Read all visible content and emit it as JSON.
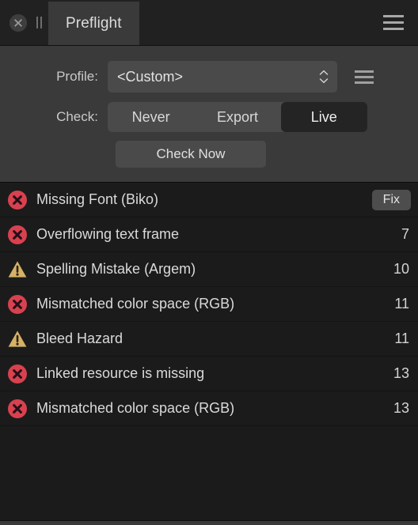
{
  "window": {
    "titlebar": {
      "close_icon": "close-circle-icon",
      "drag_handle_icon": "pause-bars-icon",
      "tab_label": "Preflight",
      "menu_icon": "hamburger-menu-icon"
    }
  },
  "controls": {
    "profile": {
      "label": "Profile:",
      "value": "<Custom>",
      "stepper_icon": "up-down-chevrons-icon",
      "menu_icon": "hamburger-menu-icon"
    },
    "check": {
      "label": "Check:",
      "options": [
        {
          "label": "Never",
          "selected": false
        },
        {
          "label": "Export",
          "selected": false
        },
        {
          "label": "Live",
          "selected": true
        }
      ],
      "selected_value": "Live"
    },
    "check_now_label": "Check Now"
  },
  "results": {
    "rows": [
      {
        "severity": "error",
        "icon": "error-circle-icon",
        "text": "Missing Font (Biko)",
        "count": "",
        "action_label": "Fix"
      },
      {
        "severity": "error",
        "icon": "error-circle-icon",
        "text": "Overflowing text frame",
        "count": "7",
        "action_label": ""
      },
      {
        "severity": "warning",
        "icon": "warning-triangle-icon",
        "text": "Spelling Mistake (Argem)",
        "count": "10",
        "action_label": ""
      },
      {
        "severity": "error",
        "icon": "error-circle-icon",
        "text": "Mismatched color space (RGB)",
        "count": "11",
        "action_label": ""
      },
      {
        "severity": "warning",
        "icon": "warning-triangle-icon",
        "text": "Bleed Hazard",
        "count": "11",
        "action_label": ""
      },
      {
        "severity": "error",
        "icon": "error-circle-icon",
        "text": "Linked resource is missing",
        "count": "13",
        "action_label": ""
      },
      {
        "severity": "error",
        "icon": "error-circle-icon",
        "text": "Mismatched color space (RGB)",
        "count": "13",
        "action_label": ""
      }
    ]
  },
  "colors": {
    "error": "#d8414f",
    "warning": "#d6b166",
    "panel_bg": "#3a3a3a",
    "titlebar_bg": "#212121",
    "list_bg": "#1b1b1b",
    "selected_segment_bg": "#242424"
  }
}
